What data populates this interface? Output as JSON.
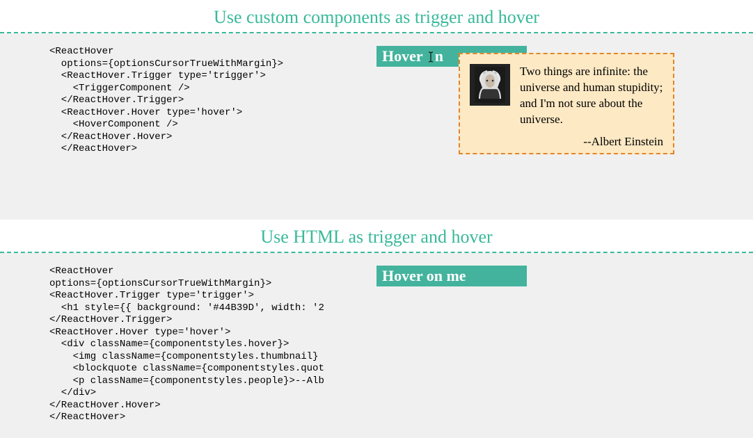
{
  "section1": {
    "title": "Use custom components as trigger and hover",
    "code": "<ReactHover\n  options={optionsCursorTrueWithMargin}>\n  <ReactHover.Trigger type='trigger'>\n    <TriggerComponent />\n  </ReactHover.Trigger>\n  <ReactHover.Hover type='hover'>\n    <HoverComponent />\n  </ReactHover.Hover>\n  </ReactHover>",
    "badge_before": "Hover ",
    "badge_after": "n",
    "tooltip_quote": "Two things are infinite: the universe and human stupidity; and I'm not sure about the universe.",
    "tooltip_attrib": "--Albert Einstein"
  },
  "section2": {
    "title": "Use HTML as trigger and hover",
    "code": "<ReactHover\noptions={optionsCursorTrueWithMargin}>\n<ReactHover.Trigger type='trigger'>\n  <h1 style={{ background: '#44B39D', width: '2\n</ReactHover.Trigger>\n<ReactHover.Hover type='hover'>\n  <div className={componentstyles.hover}>\n    <img className={componentstyles.thumbnail}\n    <blockquote className={componentstyles.quot\n    <p className={componentstyles.people}>--Alb\n  </div>\n</ReactHover.Hover>\n</ReactHover>",
    "badge": "Hover on me"
  },
  "icons": {
    "cursor-text": "text-cursor-icon"
  }
}
